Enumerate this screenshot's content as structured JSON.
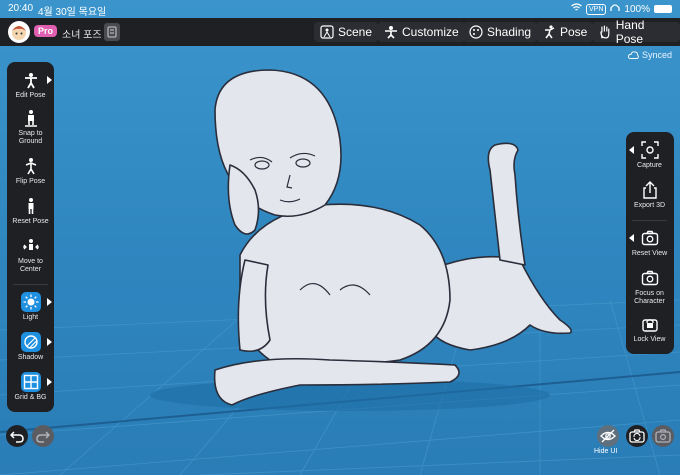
{
  "status_bar": {
    "time": "20:40",
    "date": "4월 30일 목요일",
    "vpn": "VPN",
    "battery": "100%"
  },
  "top_bar": {
    "pro_badge": "Pro",
    "file_name": "소녀 포즈 3",
    "tabs": [
      {
        "label": "Scene",
        "icon": "scene-icon"
      },
      {
        "label": "Customize",
        "icon": "customize-icon"
      },
      {
        "label": "Shading",
        "icon": "palette-icon"
      },
      {
        "label": "Pose",
        "icon": "pose-icon"
      },
      {
        "label": "Hand Pose",
        "icon": "hand-icon"
      }
    ]
  },
  "sync_status": "Synced",
  "left_tools": [
    {
      "label": "Edit Pose",
      "icon": "edit-pose-icon"
    },
    {
      "label": "Snap to Ground",
      "icon": "snap-ground-icon"
    },
    {
      "label": "Flip Pose",
      "icon": "flip-pose-icon"
    },
    {
      "label": "Reset Pose",
      "icon": "reset-pose-icon"
    },
    {
      "label": "Move to Center",
      "icon": "move-center-icon"
    },
    {
      "label": "Light",
      "icon": "light-icon"
    },
    {
      "label": "Shadow",
      "icon": "shadow-icon"
    },
    {
      "label": "Grid & BG",
      "icon": "grid-icon"
    }
  ],
  "right_tools": [
    {
      "label": "Capture",
      "icon": "capture-icon"
    },
    {
      "label": "Export 3D",
      "icon": "export-icon"
    },
    {
      "label": "Reset View",
      "icon": "reset-view-icon"
    },
    {
      "label": "Focus on Character",
      "icon": "focus-icon"
    },
    {
      "label": "Lock View",
      "icon": "lock-icon"
    }
  ],
  "bottom": {
    "hide_ui": "Hide UI"
  },
  "colors": {
    "toolbar_bg": "#1f2024",
    "viewport_bg": "#2f86bf",
    "accent_blue": "#1f8fe0",
    "pro_pink": "#e05fb0"
  }
}
